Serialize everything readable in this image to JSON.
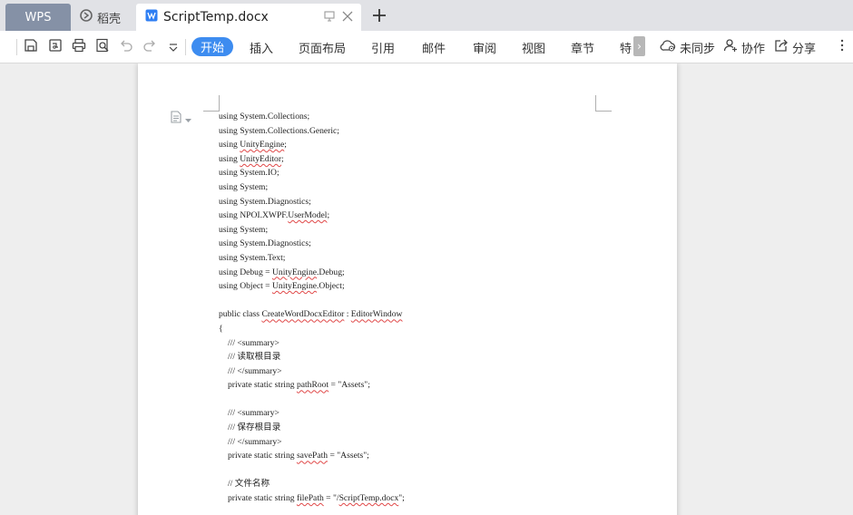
{
  "tabs": {
    "wps": "WPS",
    "daoke": "稻壳",
    "document": "ScriptTemp.docx"
  },
  "menu": {
    "active": "开始",
    "items": [
      "插入",
      "页面布局",
      "引用",
      "邮件",
      "审阅",
      "视图",
      "章节",
      "特"
    ]
  },
  "actions": {
    "sync": "未同步",
    "collaborate": "协作",
    "share": "分享"
  },
  "icons": [
    "save-icon",
    "export-pdf-icon",
    "print-icon",
    "print-preview-icon",
    "undo-icon",
    "redo-icon",
    "customize-dropdown-icon",
    "cloud-sync-icon",
    "collaborate-icon",
    "share-icon",
    "more-options-icon",
    "paragraph-icon",
    "word-doc-icon",
    "pin-icon",
    "close-icon",
    "new-tab-icon"
  ],
  "colors": {
    "active_tab_bg": "#3d8cf0",
    "wps_tab_bg": "#8591a6",
    "spell_squiggle": "#e04848"
  },
  "document": {
    "lines": {
      "l1": "using System.Collections;",
      "l2": "using System.Collections.Generic;",
      "l3_a": "using ",
      "l3_b": "UnityEngine",
      "l3_c": ";",
      "l4_a": "using ",
      "l4_b": "UnityEditor",
      "l4_c": ";",
      "l5": "using System.IO;",
      "l6": "using System;",
      "l7": "using System.Diagnostics;",
      "l8_a": "using NPOI.XWPF.",
      "l8_b": "UserModel",
      "l8_c": ";",
      "l9": "using System;",
      "l10": "using System.Diagnostics;",
      "l11": "using System.Text;",
      "l12_a": "using Debug = ",
      "l12_b": "UnityEngine",
      "l12_c": ".Debug;",
      "l13_a": "using Object = ",
      "l13_b": "UnityEngine",
      "l13_c": ".Object;",
      "l15_a": "public class ",
      "l15_b": "CreateWordDocxEditor",
      "l15_c": " : ",
      "l15_d": "EditorWindow",
      "l16": "{",
      "l17": "/// <summary>",
      "l18": "/// 读取根目录",
      "l19": "/// </summary>",
      "l20_a": "private static string ",
      "l20_b": "pathRoot",
      "l20_c": " = \"Assets\";",
      "l22": "/// <summary>",
      "l23": "/// 保存根目录",
      "l24": "/// </summary>",
      "l25_a": "private static string ",
      "l25_b": "savePath",
      "l25_c": " = \"Assets\";",
      "l27": "// 文件名称",
      "l28_a": "private static string ",
      "l28_b": "filePath",
      "l28_c": " = \"/",
      "l28_d": "ScriptTemp.docx",
      "l28_e": "\";"
    }
  }
}
